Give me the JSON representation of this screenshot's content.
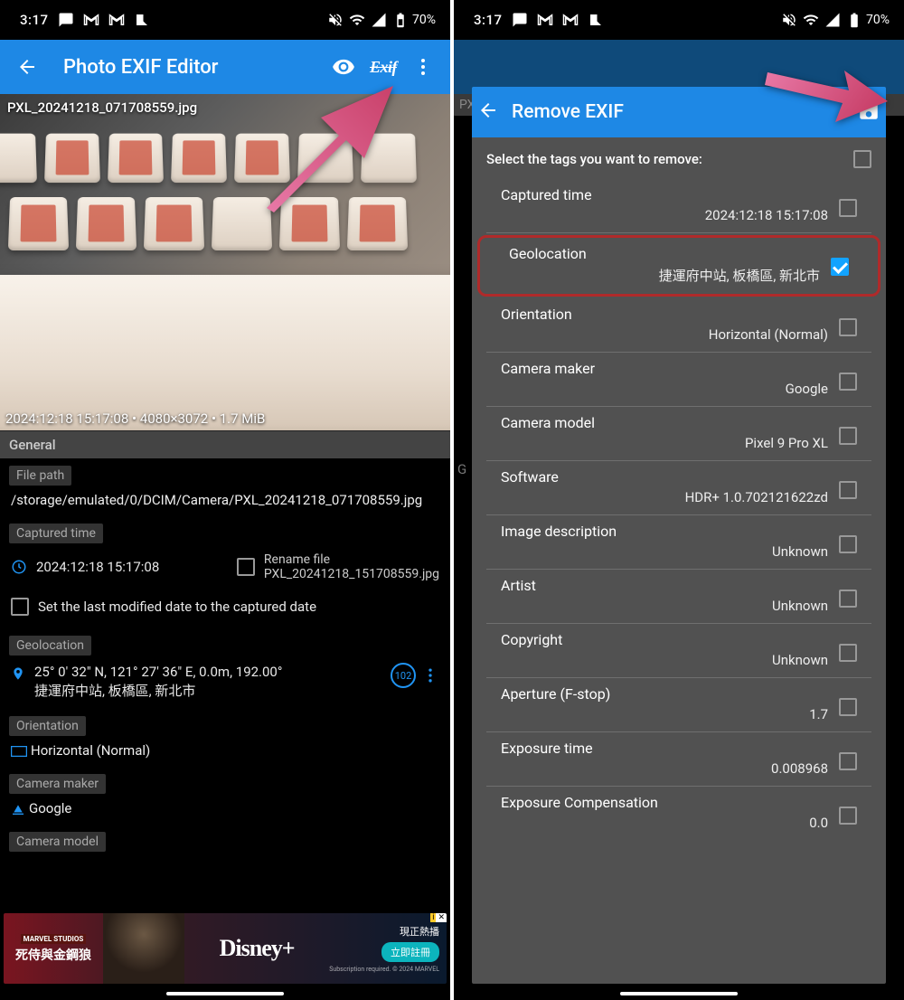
{
  "statusbar": {
    "time": "3:17",
    "battery": "70%"
  },
  "left": {
    "appbar": {
      "title": "Photo EXIF Editor",
      "exif_button": "Exif"
    },
    "photo": {
      "filename": "PXL_20241218_071708559.jpg",
      "info_overlay": "2024:12:18 15:17:08 • 4080×3072 • 1.7 MiB"
    },
    "sections": {
      "general": "General",
      "file_path_label": "File path",
      "file_path_value": "/storage/emulated/0/DCIM/Camera/PXL_20241218_071708559.jpg",
      "captured_time_label": "Captured time",
      "captured_time_value": "2024:12:18 15:17:08",
      "rename_file_label": "Rename file",
      "rename_file_value": "PXL_20241218_151708559.jpg",
      "set_last_modified": "Set the last modified date to the captured date",
      "geolocation_label": "Geolocation",
      "geolocation_coords": "25° 0' 32\" N, 121° 27' 36\" E,  0.0m, 192.00°",
      "geolocation_place": "捷運府中站, 板橋區, 新北市",
      "geolocation_badge": "102",
      "orientation_label": "Orientation",
      "orientation_value": "Horizontal (Normal)",
      "camera_maker_label": "Camera maker",
      "camera_maker_value": "Google",
      "camera_model_label": "Camera model"
    },
    "ad": {
      "marvel": "MARVEL STUDIOS",
      "film_title": "死侍與金鋼狼",
      "brand": "Disney+",
      "cta_top": "現正熱播",
      "cta_btn": "立即註冊",
      "cta_fine": "Subscription required. © 2024 MARVEL",
      "badge1": "i",
      "badge2": "✕"
    }
  },
  "right": {
    "dialog_title": "Remove EXIF",
    "instruction": "Select the tags you want to remove:",
    "items": [
      {
        "label": "Captured time",
        "value": "2024:12:18 15:17:08",
        "checked": false
      },
      {
        "label": "Geolocation",
        "value": "捷運府中站, 板橋區, 新北市",
        "checked": true,
        "highlight": true
      },
      {
        "label": "Orientation",
        "value": "Horizontal (Normal)",
        "checked": false
      },
      {
        "label": "Camera maker",
        "value": "Google",
        "checked": false
      },
      {
        "label": "Camera model",
        "value": "Pixel 9 Pro XL",
        "checked": false
      },
      {
        "label": "Software",
        "value": "HDR+ 1.0.702121622zd",
        "checked": false
      },
      {
        "label": "Image description",
        "value": "Unknown",
        "checked": false
      },
      {
        "label": "Artist",
        "value": "Unknown",
        "checked": false
      },
      {
        "label": "Copyright",
        "value": "Unknown",
        "checked": false
      },
      {
        "label": "Aperture (F-stop)",
        "value": "1.7",
        "checked": false
      },
      {
        "label": "Exposure time",
        "value": "0.008968",
        "checked": false
      },
      {
        "label": "Exposure Compensation",
        "value": "0.0",
        "checked": false
      }
    ]
  }
}
